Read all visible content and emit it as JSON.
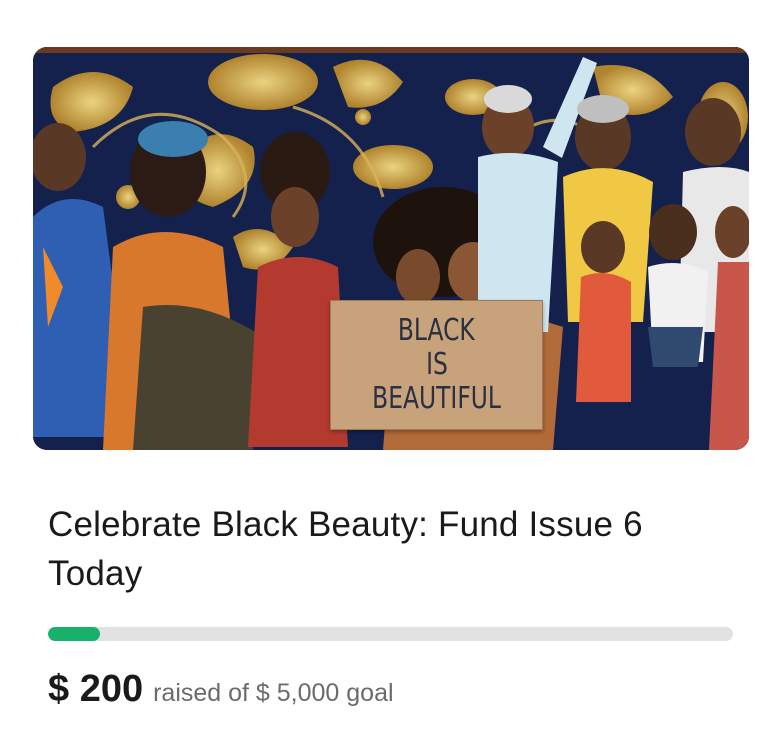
{
  "campaign": {
    "title": "Celebrate Black Beauty: Fund Issue 6 Today",
    "raised_amount": "$ 200",
    "raised_caption": "raised of $ 5,000 goal",
    "progress_fraction": 0.04,
    "colors": {
      "progress_fill": "#18b06a",
      "progress_track": "#e2e2e2"
    }
  },
  "hero": {
    "sign_lines": [
      "BLACK",
      "IS",
      "BEAUTIFUL"
    ]
  }
}
